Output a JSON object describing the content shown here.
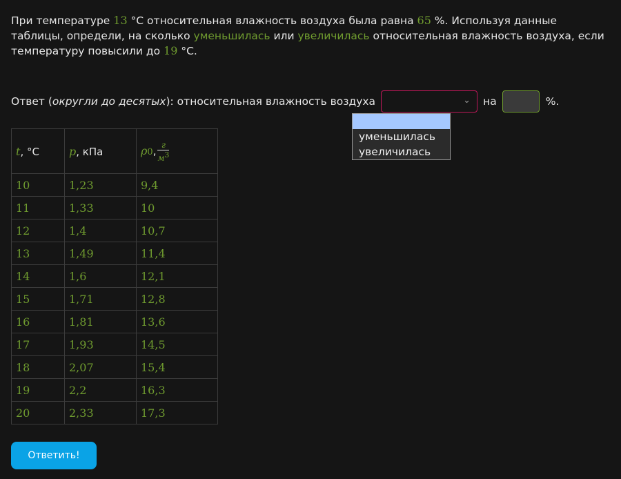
{
  "problem": {
    "p1": "При температуре ",
    "temp1": "13",
    "p2": " °C относительная влажность воздуха была равна ",
    "hum": "65",
    "p3": " %. Используя данные таблицы, определи, на сколько ",
    "kw_dec": "уменьшилась",
    "p4": " или ",
    "kw_inc": "увеличилась",
    "p5": " относительная влажность воздуха, если температуру повысили до ",
    "temp2": "19",
    "p6": " °C."
  },
  "answer": {
    "prefix": "Ответ (",
    "hint": "округли до десятых",
    "label": "): относительная влажность воздуха",
    "select_value": "",
    "on": "на",
    "percent": "%.",
    "number_value": ""
  },
  "dropdown": {
    "options": [
      "",
      "уменьшилась",
      "увеличилась"
    ]
  },
  "table": {
    "headers": {
      "t_sym": "t",
      "t_unit": ", °C",
      "p_sym": "p",
      "p_unit": ", кПа",
      "rho_sym": "ρ",
      "rho_sub": "0",
      "rho_comma": ",",
      "rho_num": "г",
      "rho_den": "м",
      "rho_exp": "3"
    },
    "rows": [
      [
        "10",
        "1,23",
        "9,4"
      ],
      [
        "11",
        "1,33",
        "10"
      ],
      [
        "12",
        "1,4",
        "10,7"
      ],
      [
        "13",
        "1,49",
        "11,4"
      ],
      [
        "14",
        "1,6",
        "12,1"
      ],
      [
        "15",
        "1,71",
        "12,8"
      ],
      [
        "16",
        "1,81",
        "13,6"
      ],
      [
        "17",
        "1,93",
        "14,5"
      ],
      [
        "18",
        "2,07",
        "15,4"
      ],
      [
        "19",
        "2,2",
        "16,3"
      ],
      [
        "20",
        "2,33",
        "17,3"
      ]
    ]
  },
  "submit_label": "Ответить!",
  "colors": {
    "accent_green": "#6f9b2f",
    "select_border": "#c2185b",
    "button_blue": "#0aa3e6",
    "highlight_option": "#a5c8ff"
  }
}
